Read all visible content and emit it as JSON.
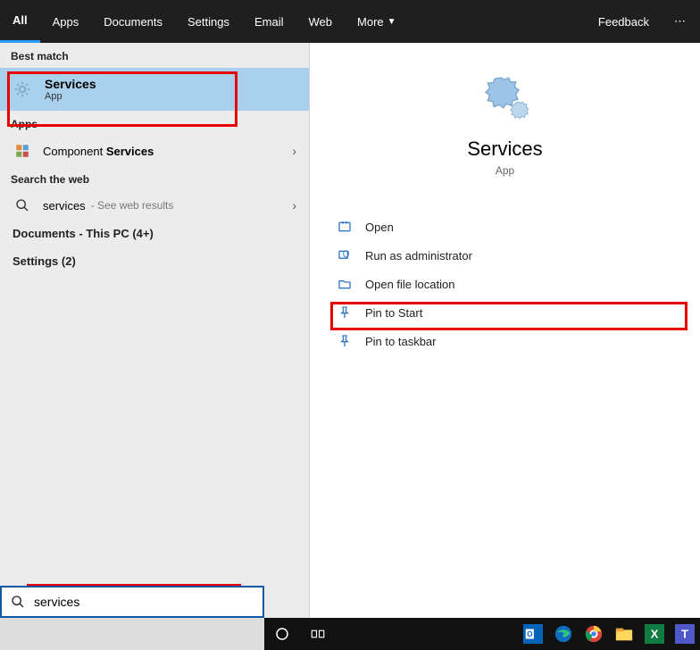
{
  "tabs": {
    "all": "All",
    "apps": "Apps",
    "documents": "Documents",
    "settings": "Settings",
    "email": "Email",
    "web": "Web",
    "more": "More",
    "feedback": "Feedback"
  },
  "left": {
    "best_match_label": "Best match",
    "best_match": {
      "title": "Services",
      "subtitle": "App"
    },
    "apps_label": "Apps",
    "apps_item_prefix": "Component ",
    "apps_item_bold": "Services",
    "search_web_label": "Search the web",
    "web_query": "services",
    "web_suffix": " - See web results",
    "documents_label": "Documents - This PC (4+)",
    "settings_label": "Settings (2)"
  },
  "detail": {
    "title": "Services",
    "subtitle": "App",
    "actions": {
      "open": "Open",
      "run_admin": "Run as administrator",
      "open_loc": "Open file location",
      "pin_start": "Pin to Start",
      "pin_taskbar": "Pin to taskbar"
    }
  },
  "search": {
    "value": "services"
  }
}
